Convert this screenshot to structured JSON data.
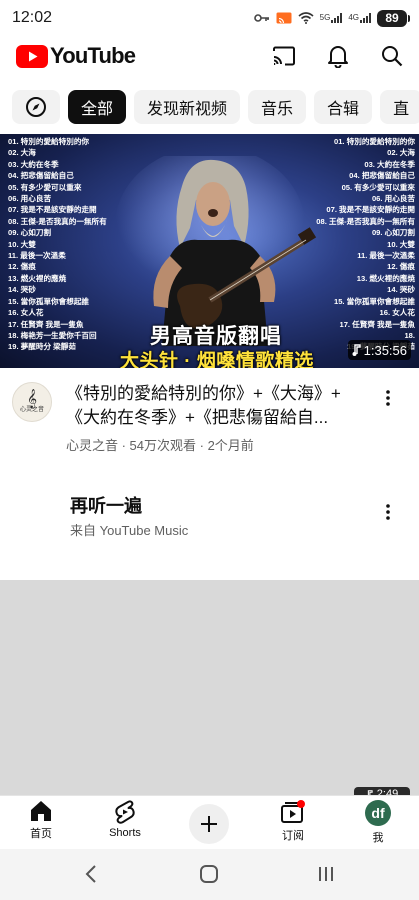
{
  "status_bar": {
    "time": "12:02",
    "network_5g": "5G",
    "network_4g": "4G",
    "battery": "89"
  },
  "header": {
    "logo_text": "YouTube",
    "brand_color": "#ff0000"
  },
  "chips": [
    {
      "label": "全部",
      "active": true
    },
    {
      "label": "发现新视频",
      "active": false
    },
    {
      "label": "音乐",
      "active": false
    },
    {
      "label": "合辑",
      "active": false
    },
    {
      "label": "直",
      "active": false
    }
  ],
  "thumbnail": {
    "tracks_left": [
      "01. 特別的愛給特別的你",
      "02. 大海",
      "03. 大約在冬季",
      "04. 把悲傷留給自己",
      "05. 有多少愛可以重來",
      "06. 用心良苦",
      "07. 我是不是該安靜的走開",
      "08. 王傑-是否我真的一無所有",
      "09. 心如刀割",
      "10. 大雙",
      "11. 最後一次溫柔",
      "12. 傷痕",
      "13. 燃火裡的應焼",
      "14. 哭砂",
      "15. 當你孤單你會想起誰",
      "16. 女人花",
      "17. 任賢齊 我是一隻魚",
      "18. 梅艳芳一生愛你千百回",
      "19. 夢醒時分 梁靜茹"
    ],
    "tracks_right": [
      "01. 特別的愛給特別的你",
      "02. 大海",
      "03. 大約在冬季",
      "04. 把悲傷留給自己",
      "05. 有多少愛可以重來",
      "06. 用心良苦",
      "07. 我是不是該安靜的走開",
      "08. 王傑-是否我真的一無所有",
      "09. 心如刀割",
      "10. 大雙",
      "11. 最後一次溫柔",
      "12. 傷痕",
      "13. 燃火裡的應焼",
      "14. 哭砂",
      "15. 當你孤單你會想起誰",
      "16. 女人花",
      "17. 任賢齊 我是一隻魚",
      "18.",
      "19. 夢醒時分 梁靜茹"
    ],
    "title_main": "男高音版翻唱",
    "title_sub": "大头针 · 烟嗓情歌精选",
    "duration": "1:35:56"
  },
  "video": {
    "avatar_label": "心灵之音",
    "title": "《特別的愛給特別的你》+《大海》+《大約在冬季》+《把悲傷留給自...",
    "meta": "心灵之音 · 54万次观看 · 2个月前"
  },
  "replay": {
    "title": "再听一遍",
    "subtitle": "来自 YouTube Music"
  },
  "mini_badge": "2:49",
  "bottom_nav": {
    "home": "首页",
    "shorts": "Shorts",
    "subscriptions": "订阅",
    "me": "我",
    "me_avatar": "df"
  }
}
